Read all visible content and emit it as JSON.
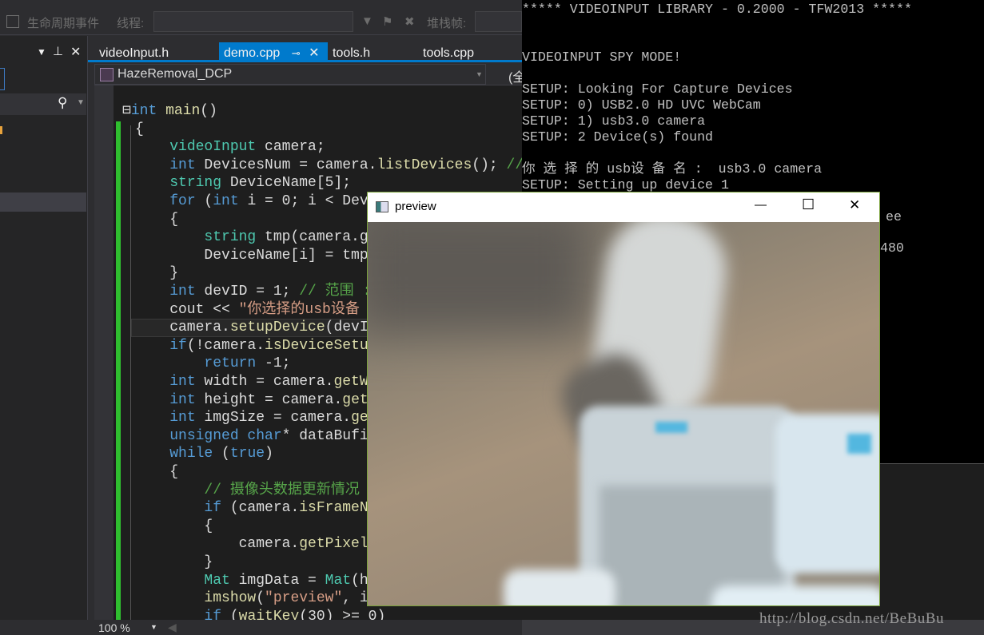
{
  "toolbar": {
    "lifecycle_label": "生命周期事件",
    "thread_label": "线程:",
    "stackframe_label": "堆栈帧:"
  },
  "tabs": [
    {
      "label": "videoInput.h",
      "active": false
    },
    {
      "label": "demo.cpp",
      "active": true,
      "pin": "⊸",
      "close": "✕"
    },
    {
      "label": "tools.h",
      "active": false
    },
    {
      "label": "tools.cpp",
      "active": false
    }
  ],
  "navbar": {
    "project": "HazeRemoval_DCP",
    "scope": "(全"
  },
  "code_lines": [
    [
      [
        "p",
        "⊟"
      ],
      [
        "k",
        "int"
      ],
      [
        "p",
        " "
      ],
      [
        "f",
        "main"
      ],
      [
        "p",
        "()"
      ]
    ],
    [
      [
        "p",
        "{"
      ]
    ],
    [
      [
        "p",
        "    "
      ],
      [
        "t",
        "videoInput"
      ],
      [
        "p",
        " camera;"
      ]
    ],
    [
      [
        "p",
        "    "
      ],
      [
        "k",
        "int"
      ],
      [
        "p",
        " DevicesNum = camera."
      ],
      [
        "f",
        "listDevices"
      ],
      [
        "p",
        "(); "
      ],
      [
        "c",
        "//"
      ]
    ],
    [
      [
        "p",
        "    "
      ],
      [
        "t",
        "string"
      ],
      [
        "p",
        " DeviceName[5];"
      ]
    ],
    [
      [
        "p",
        "    "
      ],
      [
        "k",
        "for"
      ],
      [
        "p",
        " ("
      ],
      [
        "k",
        "int"
      ],
      [
        "p",
        " i = 0; i < Dev"
      ]
    ],
    [
      [
        "p",
        "    {"
      ]
    ],
    [
      [
        "p",
        "        "
      ],
      [
        "t",
        "string"
      ],
      [
        "p",
        " tmp(camera.g"
      ]
    ],
    [
      [
        "p",
        "        DeviceName[i] = tmp"
      ]
    ],
    [
      [
        "p",
        "    }"
      ]
    ],
    [
      [
        "p",
        "    "
      ],
      [
        "k",
        "int"
      ],
      [
        "p",
        " devID = 1; "
      ],
      [
        "c",
        "// 范围 :"
      ]
    ],
    [
      [
        "p",
        "    cout << "
      ],
      [
        "s",
        "\"你选择的usb设备"
      ]
    ],
    [
      [
        "p",
        "    camera."
      ],
      [
        "f",
        "setupDevice"
      ],
      [
        "p",
        "(devI"
      ]
    ],
    [
      [
        "p",
        "    "
      ],
      [
        "k",
        "if"
      ],
      [
        "p",
        "(!camera."
      ],
      [
        "f",
        "isDeviceSetu"
      ]
    ],
    [
      [
        "p",
        "        "
      ],
      [
        "k",
        "return"
      ],
      [
        "p",
        " -1;"
      ]
    ],
    [
      [
        "p",
        "    "
      ],
      [
        "k",
        "int"
      ],
      [
        "p",
        " width = camera."
      ],
      [
        "f",
        "getW"
      ]
    ],
    [
      [
        "p",
        "    "
      ],
      [
        "k",
        "int"
      ],
      [
        "p",
        " height = camera."
      ],
      [
        "f",
        "get"
      ]
    ],
    [
      [
        "p",
        "    "
      ],
      [
        "k",
        "int"
      ],
      [
        "p",
        " imgSize = camera."
      ],
      [
        "f",
        "ge"
      ]
    ],
    [
      [
        "p",
        "    "
      ],
      [
        "k",
        "unsigned char"
      ],
      [
        "p",
        "* dataBufi"
      ]
    ],
    [
      [
        "p",
        "    "
      ],
      [
        "k",
        "while"
      ],
      [
        "p",
        " ("
      ],
      [
        "k",
        "true"
      ],
      [
        "p",
        ")"
      ]
    ],
    [
      [
        "p",
        "    {"
      ]
    ],
    [
      [
        "p",
        "        "
      ],
      [
        "c",
        "// 摄像头数据更新情况"
      ]
    ],
    [
      [
        "p",
        "        "
      ],
      [
        "k",
        "if"
      ],
      [
        "p",
        " (camera."
      ],
      [
        "f",
        "isFrameN"
      ]
    ],
    [
      [
        "p",
        "        {"
      ]
    ],
    [
      [
        "p",
        "            camera."
      ],
      [
        "f",
        "getPixel"
      ]
    ],
    [
      [
        "p",
        "        }"
      ]
    ],
    [
      [
        "p",
        "        "
      ],
      [
        "t",
        "Mat"
      ],
      [
        "p",
        " imgData = "
      ],
      [
        "t",
        "Mat"
      ],
      [
        "p",
        "(h"
      ]
    ],
    [
      [
        "p",
        "        "
      ],
      [
        "f",
        "imshow"
      ],
      [
        "p",
        "("
      ],
      [
        "s",
        "\"preview\""
      ],
      [
        "p",
        ", i"
      ]
    ],
    [
      [
        "p",
        "        "
      ],
      [
        "k",
        "if"
      ],
      [
        "p",
        " ("
      ],
      [
        "f",
        "waitKey"
      ],
      [
        "p",
        "(30) >= 0)"
      ]
    ]
  ],
  "statusbar": {
    "zoom": "100 %"
  },
  "console": {
    "lines": [
      "***** VIDEOINPUT LIBRARY - 0.2000 - TFW2013 *****",
      "",
      "",
      "VIDEOINPUT SPY MODE!",
      "",
      "SETUP: Looking For Capture Devices",
      "SETUP: 0) USB2.0 HD UVC WebCam",
      "SETUP: 1) usb3.0 camera",
      "SETUP: 2 Device(s) found",
      "",
      "你 选 择 的 usb设 备 名 :  usb3.0 camera",
      "SETUP: Setting up device 1"
    ],
    "partial_line_1": "ee",
    "partial_line_2": "480"
  },
  "preview_window": {
    "title": "preview",
    "minimize": "—",
    "maximize": "☐",
    "close": "✕"
  },
  "watermark": "http://blog.csdn.net/BeBuBu",
  "colors": {
    "accent": "#007acc",
    "change_bar": "#2fbf2f",
    "console_bg": "#000000"
  }
}
